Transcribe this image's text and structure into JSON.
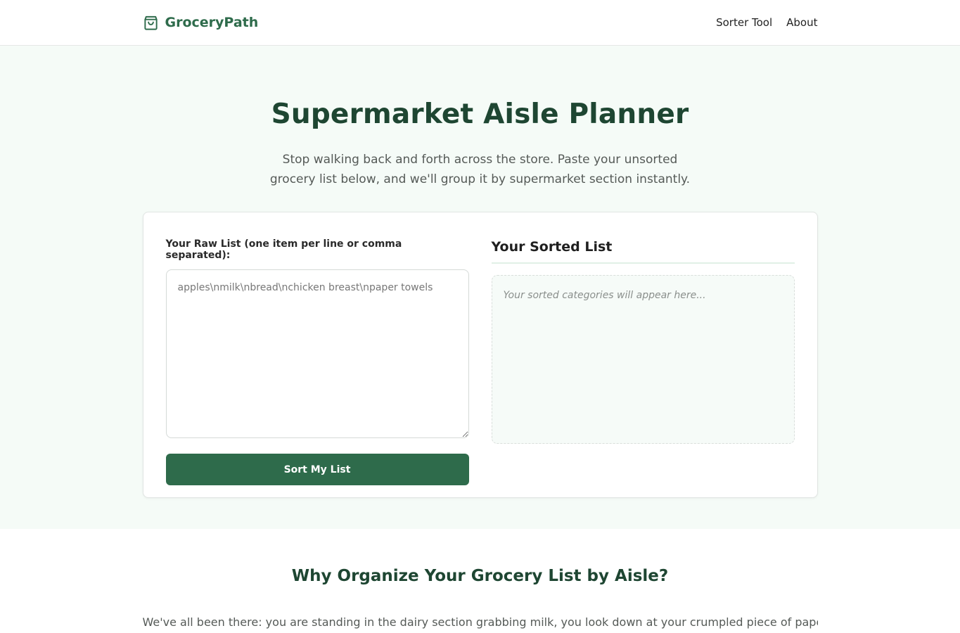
{
  "header": {
    "brand": "GroceryPath",
    "brand_icon": "shopping-bag-icon",
    "nav": [
      "Sorter Tool",
      "About"
    ]
  },
  "hero": {
    "title": "Supermarket Aisle Planner",
    "subtitle": "Stop walking back and forth across the store. Paste your unsorted grocery list below, and we'll group it by supermarket section instantly."
  },
  "tool": {
    "input_label": "Your Raw List (one item per line or comma separated):",
    "input_value": "",
    "input_placeholder": "apples\\nmilk\\nbread\\nchicken breast\\npaper towels",
    "button_label": "Sort My List",
    "output_title": "Your Sorted List",
    "output_placeholder": "Your sorted categories will appear here..."
  },
  "why": {
    "title": "Why Organize Your Grocery List by Aisle?",
    "text": "We've all been there: you are standing in the dairy section grabbing milk, you look down at your crumpled piece of paper or"
  },
  "colors": {
    "accent": "#2e6b4b",
    "heading": "#1e4632",
    "hero_bg": "#f5fbf7"
  }
}
